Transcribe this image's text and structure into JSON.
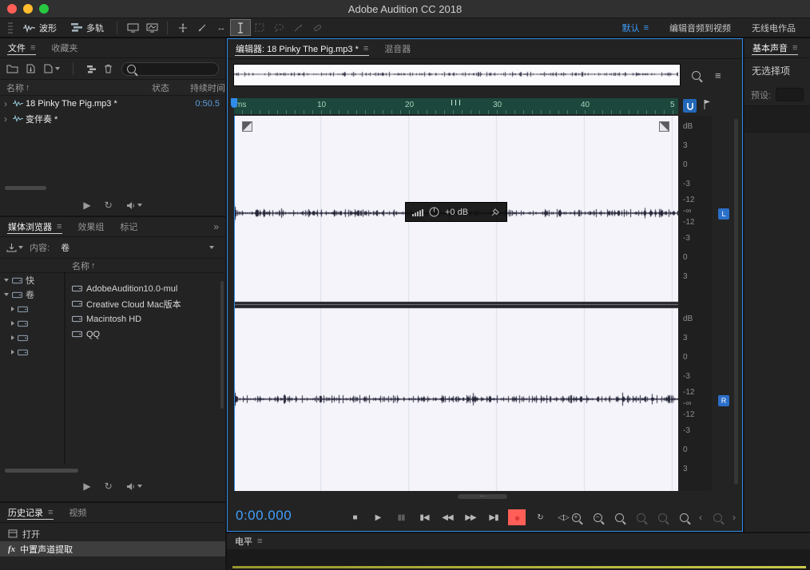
{
  "titlebar": {
    "title": "Adobe Audition CC 2018"
  },
  "icons": {
    "panel_menu": "≡",
    "overflow": "»",
    "sort_up": "↑",
    "chevron_right": "›",
    "loop": "↻",
    "slip": "↔",
    "dots": "⋯",
    "list": "≡"
  },
  "toolbar": {
    "waveform_label": "波形",
    "multitrack_label": "多轨",
    "workspace_default": "默认",
    "workspace_edit": "编辑音频到视频",
    "workspace_radio": "无线电作品"
  },
  "files_panel": {
    "tab_files": "文件",
    "tab_favorites": "收藏夹",
    "col_name": "名称",
    "col_status": "状态",
    "col_duration": "持续时间",
    "rows": [
      {
        "name": "18 Pinky The Pig.mp3 *",
        "status": "",
        "duration": "0:50.5"
      },
      {
        "name": "变伴奏 *",
        "status": "",
        "duration": ""
      }
    ]
  },
  "media_browser": {
    "tab_media": "媒体浏览器",
    "tab_effects": "效果组",
    "tab_markers": "标记",
    "content_label": "内容:",
    "content_value": "卷",
    "col_name": "名称",
    "shortcut_quick": "快",
    "shortcut_volumes": "卷",
    "items": [
      "AdobeAudition10.0-mul",
      "Creative Cloud Mac版本",
      "Macintosh HD",
      "QQ"
    ]
  },
  "history_panel": {
    "tab_history": "历史记录",
    "tab_video": "视频",
    "item_open": "打开",
    "fx_prefix": "fx",
    "item_fx": "中置声道提取"
  },
  "editor": {
    "tab_editor": "编辑器: 18 Pinky The Pig.mp3 *",
    "tab_mixer": "混音器",
    "ruler_ticks": [
      "ms",
      "10",
      "20",
      "30",
      "40",
      "5"
    ],
    "hud_gain": "+0 dB",
    "time_display": "0:00.000",
    "db_scale": [
      "dB",
      "3",
      "0",
      "-3",
      "-12",
      "-∞",
      "-12",
      "-3",
      "0",
      "3"
    ],
    "channel_left": "L",
    "channel_right": "R",
    "transport_buttons": [
      {
        "name": "stop-button",
        "glyph": "■"
      },
      {
        "name": "play-button",
        "glyph": "▶"
      },
      {
        "name": "pause-button",
        "glyph": "▮▮",
        "dim": true
      },
      {
        "name": "go-to-start-button",
        "glyph": "▮◀"
      },
      {
        "name": "rewind-button",
        "glyph": "◀◀"
      },
      {
        "name": "fast-forward-button",
        "glyph": "▶▶"
      },
      {
        "name": "go-to-end-button",
        "glyph": "▶▮"
      },
      {
        "name": "record-button",
        "glyph": "●",
        "red": true
      },
      {
        "name": "loop-playback-button",
        "glyph": "↻"
      },
      {
        "name": "skip-selection-button",
        "glyph": "◁▷"
      }
    ]
  },
  "essential_sound": {
    "tab_title": "基本声音",
    "empty_text": "无选择项",
    "preset_label": "预设:"
  },
  "levels_panel": {
    "title": "电平"
  },
  "colors": {
    "accent_blue": "#2f8ceb",
    "record_red": "#e03a3a",
    "ruler_bg": "#1c473c",
    "wave_bg": "#f4f4fa"
  }
}
